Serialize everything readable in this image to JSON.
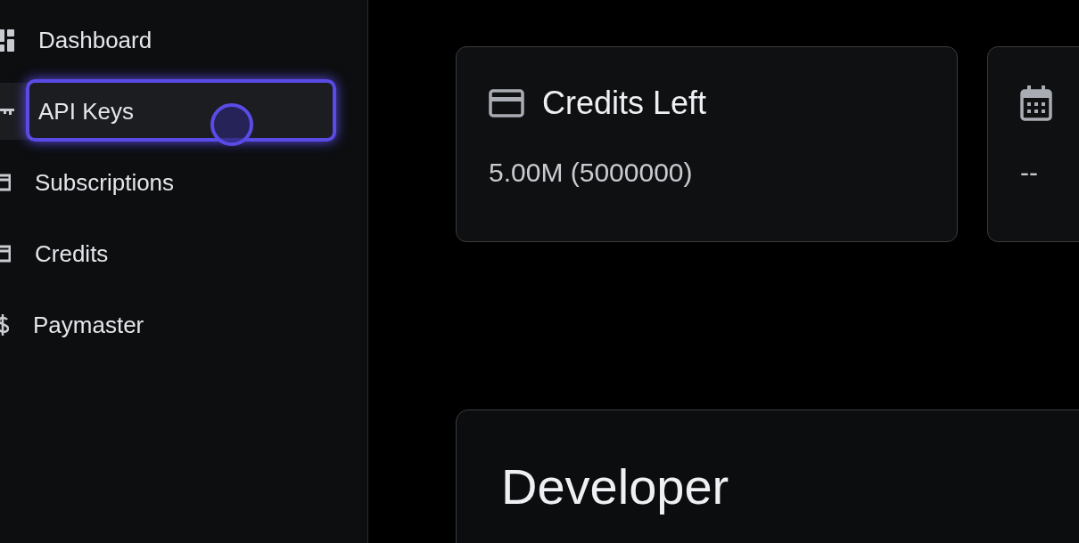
{
  "sidebar": {
    "items": [
      {
        "label": "Dashboard",
        "kind": "dashboard",
        "selected": false
      },
      {
        "label": "API Keys",
        "kind": "key",
        "selected": true
      },
      {
        "label": "Subscriptions",
        "kind": "card",
        "selected": false
      },
      {
        "label": "Credits",
        "kind": "card",
        "selected": false
      },
      {
        "label": "Paymaster",
        "kind": "dollar",
        "selected": false
      }
    ]
  },
  "stats": [
    {
      "kind": "card",
      "title": "Credits Left",
      "value": "5.00M (5000000)"
    },
    {
      "kind": "calendar",
      "value": "--"
    }
  ],
  "developer_panel": {
    "title": "Developer"
  }
}
